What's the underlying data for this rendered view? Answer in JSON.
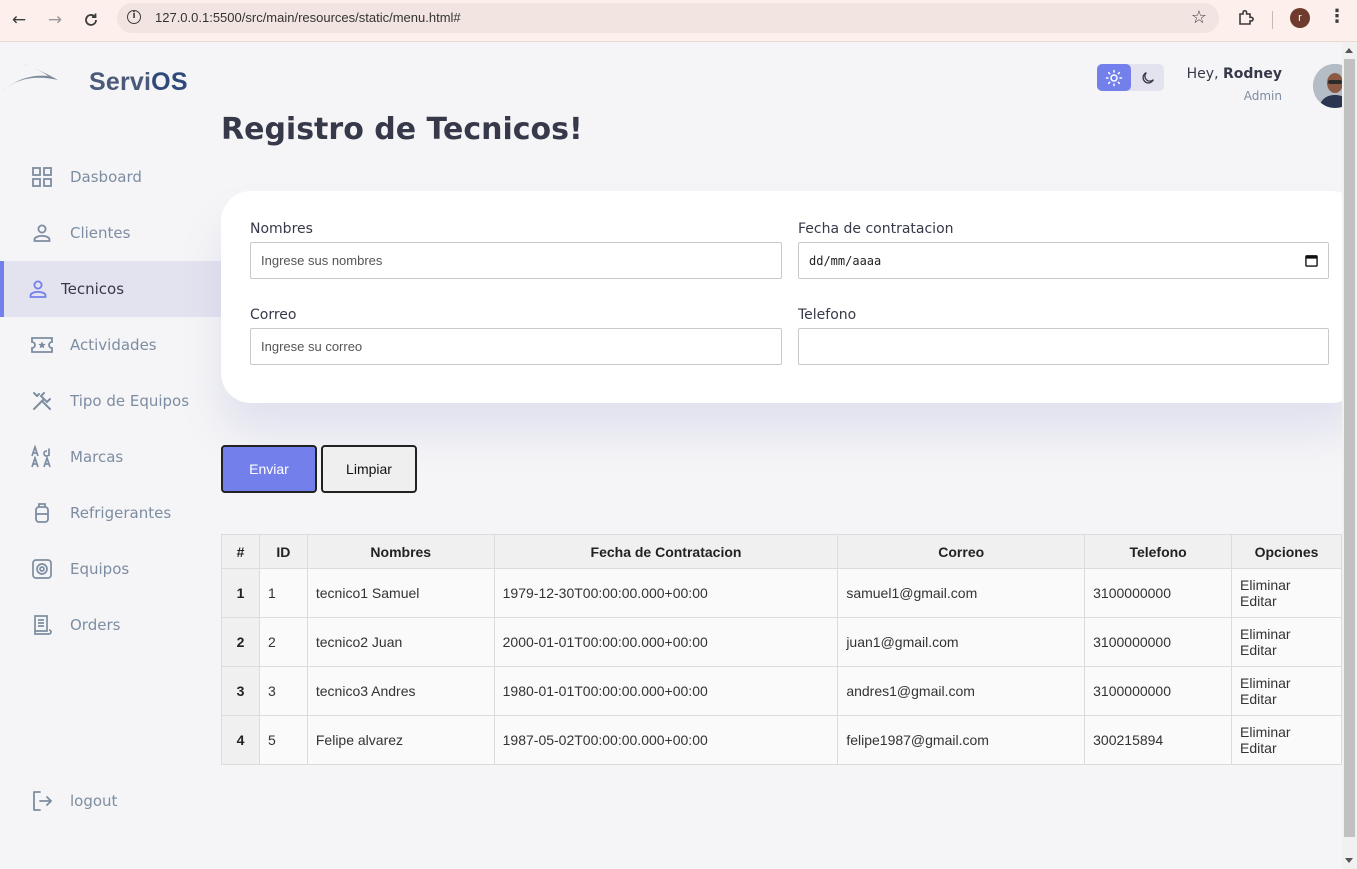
{
  "browser": {
    "url": "127.0.0.1:5500/src/main/resources/static/menu.html#",
    "profile_initial": "r"
  },
  "brand": {
    "name_part1": "Servi",
    "name_part2": "OS"
  },
  "sidebar": {
    "items": [
      {
        "label": "Dasboard",
        "icon": "grid-icon",
        "active": false
      },
      {
        "label": "Clientes",
        "icon": "person-icon",
        "active": false
      },
      {
        "label": "Tecnicos",
        "icon": "person-icon",
        "active": true
      },
      {
        "label": "Actividades",
        "icon": "ticket-star-icon",
        "active": false
      },
      {
        "label": "Tipo de Equipos",
        "icon": "tools-icon",
        "active": false
      },
      {
        "label": "Marcas",
        "icon": "font-download-icon",
        "active": false
      },
      {
        "label": "Refrigerantes",
        "icon": "propane-tank-icon",
        "active": false
      },
      {
        "label": "Equipos",
        "icon": "settings-icon",
        "active": false
      },
      {
        "label": "Orders",
        "icon": "receipt-icon",
        "active": false
      }
    ],
    "logout_label": "logout"
  },
  "header": {
    "greeting_prefix": "Hey, ",
    "user_name": "Rodney",
    "role": "Admin",
    "theme": "light"
  },
  "page_title": "Registro de Tecnicos!",
  "form": {
    "nombres": {
      "label": "Nombres",
      "placeholder": "Ingrese sus nombres",
      "value": ""
    },
    "fecha": {
      "label": "Fecha de contratacion",
      "placeholder": "dd/mm/aaaa",
      "value": ""
    },
    "correo": {
      "label": "Correo",
      "placeholder": "Ingrese su correo",
      "value": ""
    },
    "telefono": {
      "label": "Telefono",
      "placeholder": "",
      "value": ""
    }
  },
  "buttons": {
    "send": "Enviar",
    "clear": "Limpiar"
  },
  "table": {
    "headers": [
      "#",
      "ID",
      "Nombres",
      "Fecha de Contratacion",
      "Correo",
      "Telefono",
      "Opciones"
    ],
    "rows": [
      {
        "n": "1",
        "id": "1",
        "nombres": "tecnico1 Samuel",
        "fecha": "1979-12-30T00:00:00.000+00:00",
        "correo": "samuel1@gmail.com",
        "telefono": "3100000000",
        "eliminar": "Eliminar",
        "editar": "Editar"
      },
      {
        "n": "2",
        "id": "2",
        "nombres": "tecnico2 Juan",
        "fecha": "2000-01-01T00:00:00.000+00:00",
        "correo": "juan1@gmail.com",
        "telefono": "3100000000",
        "eliminar": "Eliminar",
        "editar": "Editar"
      },
      {
        "n": "3",
        "id": "3",
        "nombres": "tecnico3 Andres",
        "fecha": "1980-01-01T00:00:00.000+00:00",
        "correo": "andres1@gmail.com",
        "telefono": "3100000000",
        "eliminar": "Eliminar",
        "editar": "Editar"
      },
      {
        "n": "4",
        "id": "5",
        "nombres": "Felipe alvarez",
        "fecha": "1987-05-02T00:00:00.000+00:00",
        "correo": "felipe1987@gmail.com",
        "telefono": "300215894",
        "eliminar": "Eliminar",
        "editar": "Editar"
      }
    ]
  },
  "colors": {
    "primary": "#7380ec",
    "text": "#363949",
    "muted": "#7d8da1",
    "background": "#f5f5f7"
  }
}
